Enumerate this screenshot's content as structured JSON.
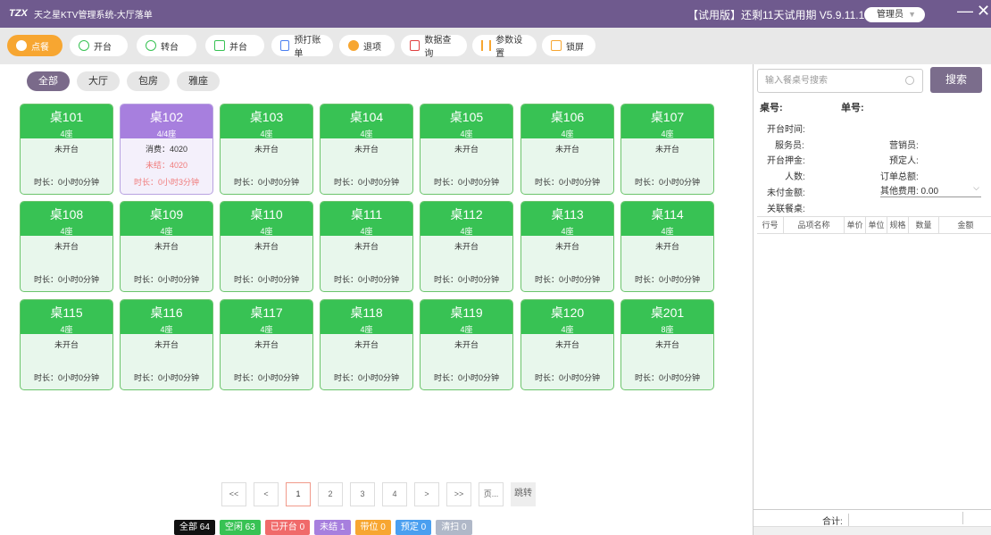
{
  "titlebar": {
    "logo": "TZX",
    "title": "天之星KTV管理系统-大厅落单",
    "trial": "【试用版】还剩11天试用期 V5.9.11.19",
    "user": "管理员",
    "min": "—",
    "close": "✕"
  },
  "toolbar": {
    "items": [
      {
        "label": "点餐",
        "icon": "dot-icon",
        "active": true
      },
      {
        "label": "开台",
        "icon": "play-circle-icon"
      },
      {
        "label": "转台",
        "icon": "transfer-icon"
      },
      {
        "label": "并台",
        "icon": "merge-icon"
      },
      {
        "label": "预打账单",
        "icon": "bill-icon"
      },
      {
        "label": "退项",
        "icon": "return-icon"
      },
      {
        "label": "数据查询",
        "icon": "query-icon"
      },
      {
        "label": "参数设置",
        "icon": "settings-icon"
      },
      {
        "label": "锁屏",
        "icon": "lock-icon"
      }
    ]
  },
  "filters": [
    "全部",
    "大厅",
    "包房",
    "雅座"
  ],
  "tables": [
    {
      "name": "桌101",
      "seats": "4座",
      "status": "未开台",
      "duration": "时长：0小时0分钟"
    },
    {
      "name": "桌102",
      "seats": "4/4座",
      "status": "消费：4020",
      "unpaid": "未结：4020",
      "duration": "时长：0小时3分钟",
      "busy": true
    },
    {
      "name": "桌103",
      "seats": "4座",
      "status": "未开台",
      "duration": "时长：0小时0分钟"
    },
    {
      "name": "桌104",
      "seats": "4座",
      "status": "未开台",
      "duration": "时长：0小时0分钟"
    },
    {
      "name": "桌105",
      "seats": "4座",
      "status": "未开台",
      "duration": "时长：0小时0分钟"
    },
    {
      "name": "桌106",
      "seats": "4座",
      "status": "未开台",
      "duration": "时长：0小时0分钟"
    },
    {
      "name": "桌107",
      "seats": "4座",
      "status": "未开台",
      "duration": "时长：0小时0分钟"
    },
    {
      "name": "桌108",
      "seats": "4座",
      "status": "未开台",
      "duration": "时长：0小时0分钟"
    },
    {
      "name": "桌109",
      "seats": "4座",
      "status": "未开台",
      "duration": "时长：0小时0分钟"
    },
    {
      "name": "桌110",
      "seats": "4座",
      "status": "未开台",
      "duration": "时长：0小时0分钟"
    },
    {
      "name": "桌111",
      "seats": "4座",
      "status": "未开台",
      "duration": "时长：0小时0分钟"
    },
    {
      "name": "桌112",
      "seats": "4座",
      "status": "未开台",
      "duration": "时长：0小时0分钟"
    },
    {
      "name": "桌113",
      "seats": "4座",
      "status": "未开台",
      "duration": "时长：0小时0分钟"
    },
    {
      "name": "桌114",
      "seats": "4座",
      "status": "未开台",
      "duration": "时长：0小时0分钟"
    },
    {
      "name": "桌115",
      "seats": "4座",
      "status": "未开台",
      "duration": "时长：0小时0分钟"
    },
    {
      "name": "桌116",
      "seats": "4座",
      "status": "未开台",
      "duration": "时长：0小时0分钟"
    },
    {
      "name": "桌117",
      "seats": "4座",
      "status": "未开台",
      "duration": "时长：0小时0分钟"
    },
    {
      "name": "桌118",
      "seats": "4座",
      "status": "未开台",
      "duration": "时长：0小时0分钟"
    },
    {
      "name": "桌119",
      "seats": "4座",
      "status": "未开台",
      "duration": "时长：0小时0分钟"
    },
    {
      "name": "桌120",
      "seats": "4座",
      "status": "未开台",
      "duration": "时长：0小时0分钟"
    },
    {
      "name": "桌201",
      "seats": "8座",
      "status": "未开台",
      "duration": "时长：0小时0分钟"
    }
  ],
  "pager": [
    "<<",
    "<",
    "1",
    "2",
    "3",
    "4",
    ">",
    ">>",
    "页...",
    "跳转"
  ],
  "legend": [
    {
      "label": "全部 64",
      "color": "#111111"
    },
    {
      "label": "空闲 63",
      "color": "#38c254"
    },
    {
      "label": "已开台 0",
      "color": "#f06a6a"
    },
    {
      "label": "未结 1",
      "color": "#a77fde"
    },
    {
      "label": "带位 0",
      "color": "#f7a631"
    },
    {
      "label": "预定 0",
      "color": "#4a9ff0"
    },
    {
      "label": "清扫 0",
      "color": "#b0b8c8"
    }
  ],
  "right": {
    "search_placeholder": "输入餐桌号搜索",
    "search_btn": "搜索",
    "table_no": "桌号:",
    "order_no": "单号:",
    "open_time": "开台时间:",
    "waiter": "服务员:",
    "sales": "营销员:",
    "deposit": "开台押金:",
    "reserver": "预定人:",
    "people": "人数:",
    "order_total": "订单总额:",
    "unpaid_amount": "未付金额:",
    "other_fee": "其他费用: 0.00",
    "linked": "关联餐桌:",
    "columns": [
      "行号",
      "品项名称",
      "单价",
      "单位",
      "规格",
      "数量",
      "金额"
    ],
    "total": "合计:"
  }
}
